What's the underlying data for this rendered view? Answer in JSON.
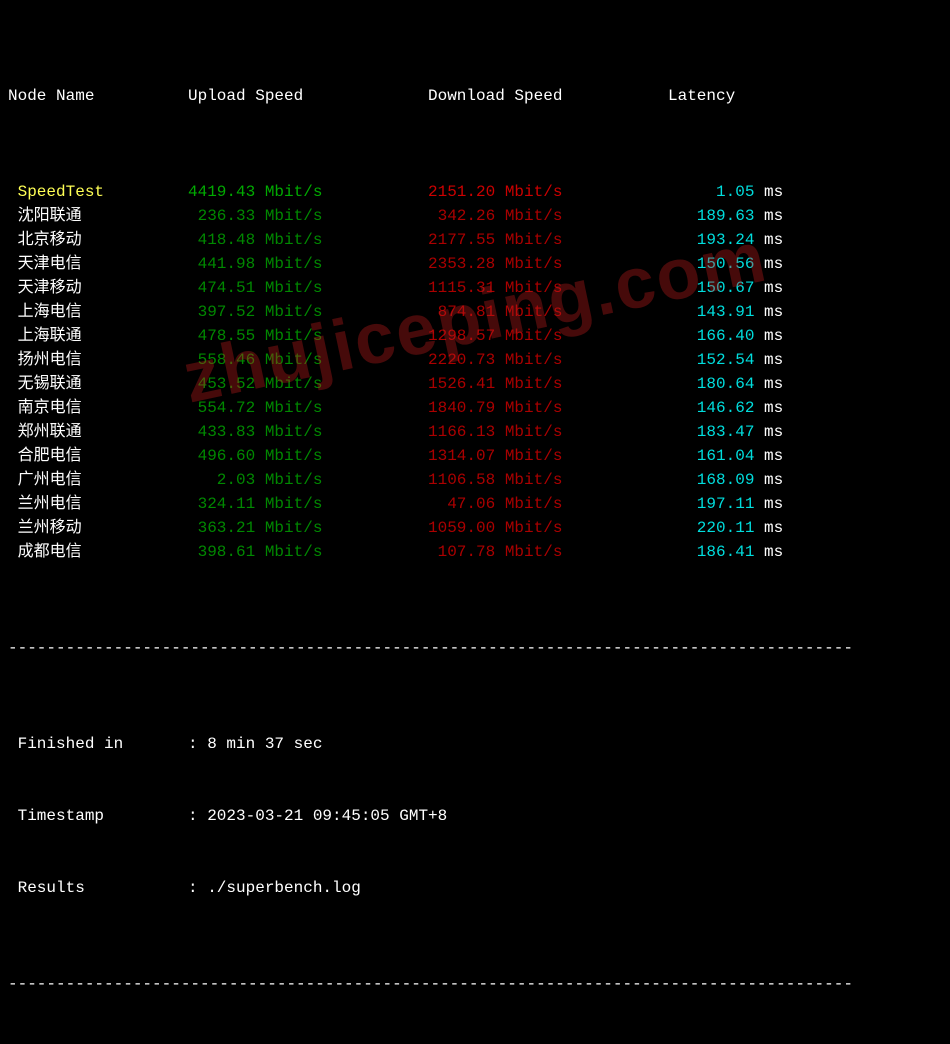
{
  "chart_data": {
    "type": "table",
    "title": "SpeedTest Results",
    "columns": [
      "Node Name",
      "Upload Speed",
      "Download Speed",
      "Latency"
    ],
    "rows": [
      [
        "SpeedTest",
        "4419.43 Mbit/s",
        "2151.20 Mbit/s",
        "1.05 ms"
      ],
      [
        "沈阳联通",
        "236.33 Mbit/s",
        "342.26 Mbit/s",
        "189.63 ms"
      ],
      [
        "北京移动",
        "418.48 Mbit/s",
        "2177.55 Mbit/s",
        "193.24 ms"
      ],
      [
        "天津电信",
        "441.98 Mbit/s",
        "2353.28 Mbit/s",
        "150.56 ms"
      ],
      [
        "天津移动",
        "474.51 Mbit/s",
        "1115.31 Mbit/s",
        "150.67 ms"
      ],
      [
        "上海电信",
        "397.52 Mbit/s",
        "874.81 Mbit/s",
        "143.91 ms"
      ],
      [
        "上海联通",
        "478.55 Mbit/s",
        "1298.57 Mbit/s",
        "166.40 ms"
      ],
      [
        "扬州电信",
        "558.46 Mbit/s",
        "2220.73 Mbit/s",
        "152.54 ms"
      ],
      [
        "无锡联通",
        "453.52 Mbit/s",
        "1526.41 Mbit/s",
        "180.64 ms"
      ],
      [
        "南京电信",
        "554.72 Mbit/s",
        "1840.79 Mbit/s",
        "146.62 ms"
      ],
      [
        "郑州联通",
        "433.83 Mbit/s",
        "1166.13 Mbit/s",
        "183.47 ms"
      ],
      [
        "合肥电信",
        "496.60 Mbit/s",
        "1314.07 Mbit/s",
        "161.04 ms"
      ],
      [
        "广州电信",
        "2.03 Mbit/s",
        "1106.58 Mbit/s",
        "168.09 ms"
      ],
      [
        "兰州电信",
        "324.11 Mbit/s",
        "47.06 Mbit/s",
        "197.11 ms"
      ],
      [
        "兰州移动",
        "363.21 Mbit/s",
        "1059.00 Mbit/s",
        "220.11 ms"
      ],
      [
        "成都电信",
        "398.61 Mbit/s",
        "107.78 Mbit/s",
        "186.41 ms"
      ]
    ]
  },
  "headers": {
    "node": "Node Name",
    "upload": "Upload Speed",
    "download": "Download Speed",
    "latency": "Latency"
  },
  "rows": [
    {
      "node": "SpeedTest",
      "upload": "4419.43 Mbit/s",
      "download": "2151.20 Mbit/s",
      "latency": "1.05 ms",
      "special": true
    },
    {
      "node": "沈阳联通",
      "upload": "236.33 Mbit/s",
      "download": "342.26 Mbit/s",
      "latency": "189.63 ms"
    },
    {
      "node": "北京移动",
      "upload": "418.48 Mbit/s",
      "download": "2177.55 Mbit/s",
      "latency": "193.24 ms"
    },
    {
      "node": "天津电信",
      "upload": "441.98 Mbit/s",
      "download": "2353.28 Mbit/s",
      "latency": "150.56 ms"
    },
    {
      "node": "天津移动",
      "upload": "474.51 Mbit/s",
      "download": "1115.31 Mbit/s",
      "latency": "150.67 ms"
    },
    {
      "node": "上海电信",
      "upload": "397.52 Mbit/s",
      "download": "874.81 Mbit/s",
      "latency": "143.91 ms"
    },
    {
      "node": "上海联通",
      "upload": "478.55 Mbit/s",
      "download": "1298.57 Mbit/s",
      "latency": "166.40 ms"
    },
    {
      "node": "扬州电信",
      "upload": "558.46 Mbit/s",
      "download": "2220.73 Mbit/s",
      "latency": "152.54 ms"
    },
    {
      "node": "无锡联通",
      "upload": "453.52 Mbit/s",
      "download": "1526.41 Mbit/s",
      "latency": "180.64 ms"
    },
    {
      "node": "南京电信",
      "upload": "554.72 Mbit/s",
      "download": "1840.79 Mbit/s",
      "latency": "146.62 ms"
    },
    {
      "node": "郑州联通",
      "upload": "433.83 Mbit/s",
      "download": "1166.13 Mbit/s",
      "latency": "183.47 ms"
    },
    {
      "node": "合肥电信",
      "upload": "496.60 Mbit/s",
      "download": "1314.07 Mbit/s",
      "latency": "161.04 ms"
    },
    {
      "node": "广州电信",
      "upload": "2.03 Mbit/s",
      "download": "1106.58 Mbit/s",
      "latency": "168.09 ms"
    },
    {
      "node": "兰州电信",
      "upload": "324.11 Mbit/s",
      "download": "47.06 Mbit/s",
      "latency": "197.11 ms"
    },
    {
      "node": "兰州移动",
      "upload": "363.21 Mbit/s",
      "download": "1059.00 Mbit/s",
      "latency": "220.11 ms"
    },
    {
      "node": "成都电信",
      "upload": "398.61 Mbit/s",
      "download": "107.78 Mbit/s",
      "latency": "186.41 ms"
    }
  ],
  "divider": "----------------------------------------------------------------------------------------",
  "footer": {
    "finished_label": " Finished in",
    "finished_value": ": 8 min 37 sec",
    "timestamp_label": " Timestamp",
    "timestamp_value": ": 2023-03-21 09:45:05 GMT+8",
    "results_label": " Results",
    "results_value": ": ./superbench.log"
  },
  "watermark": "zhujiceping.com"
}
